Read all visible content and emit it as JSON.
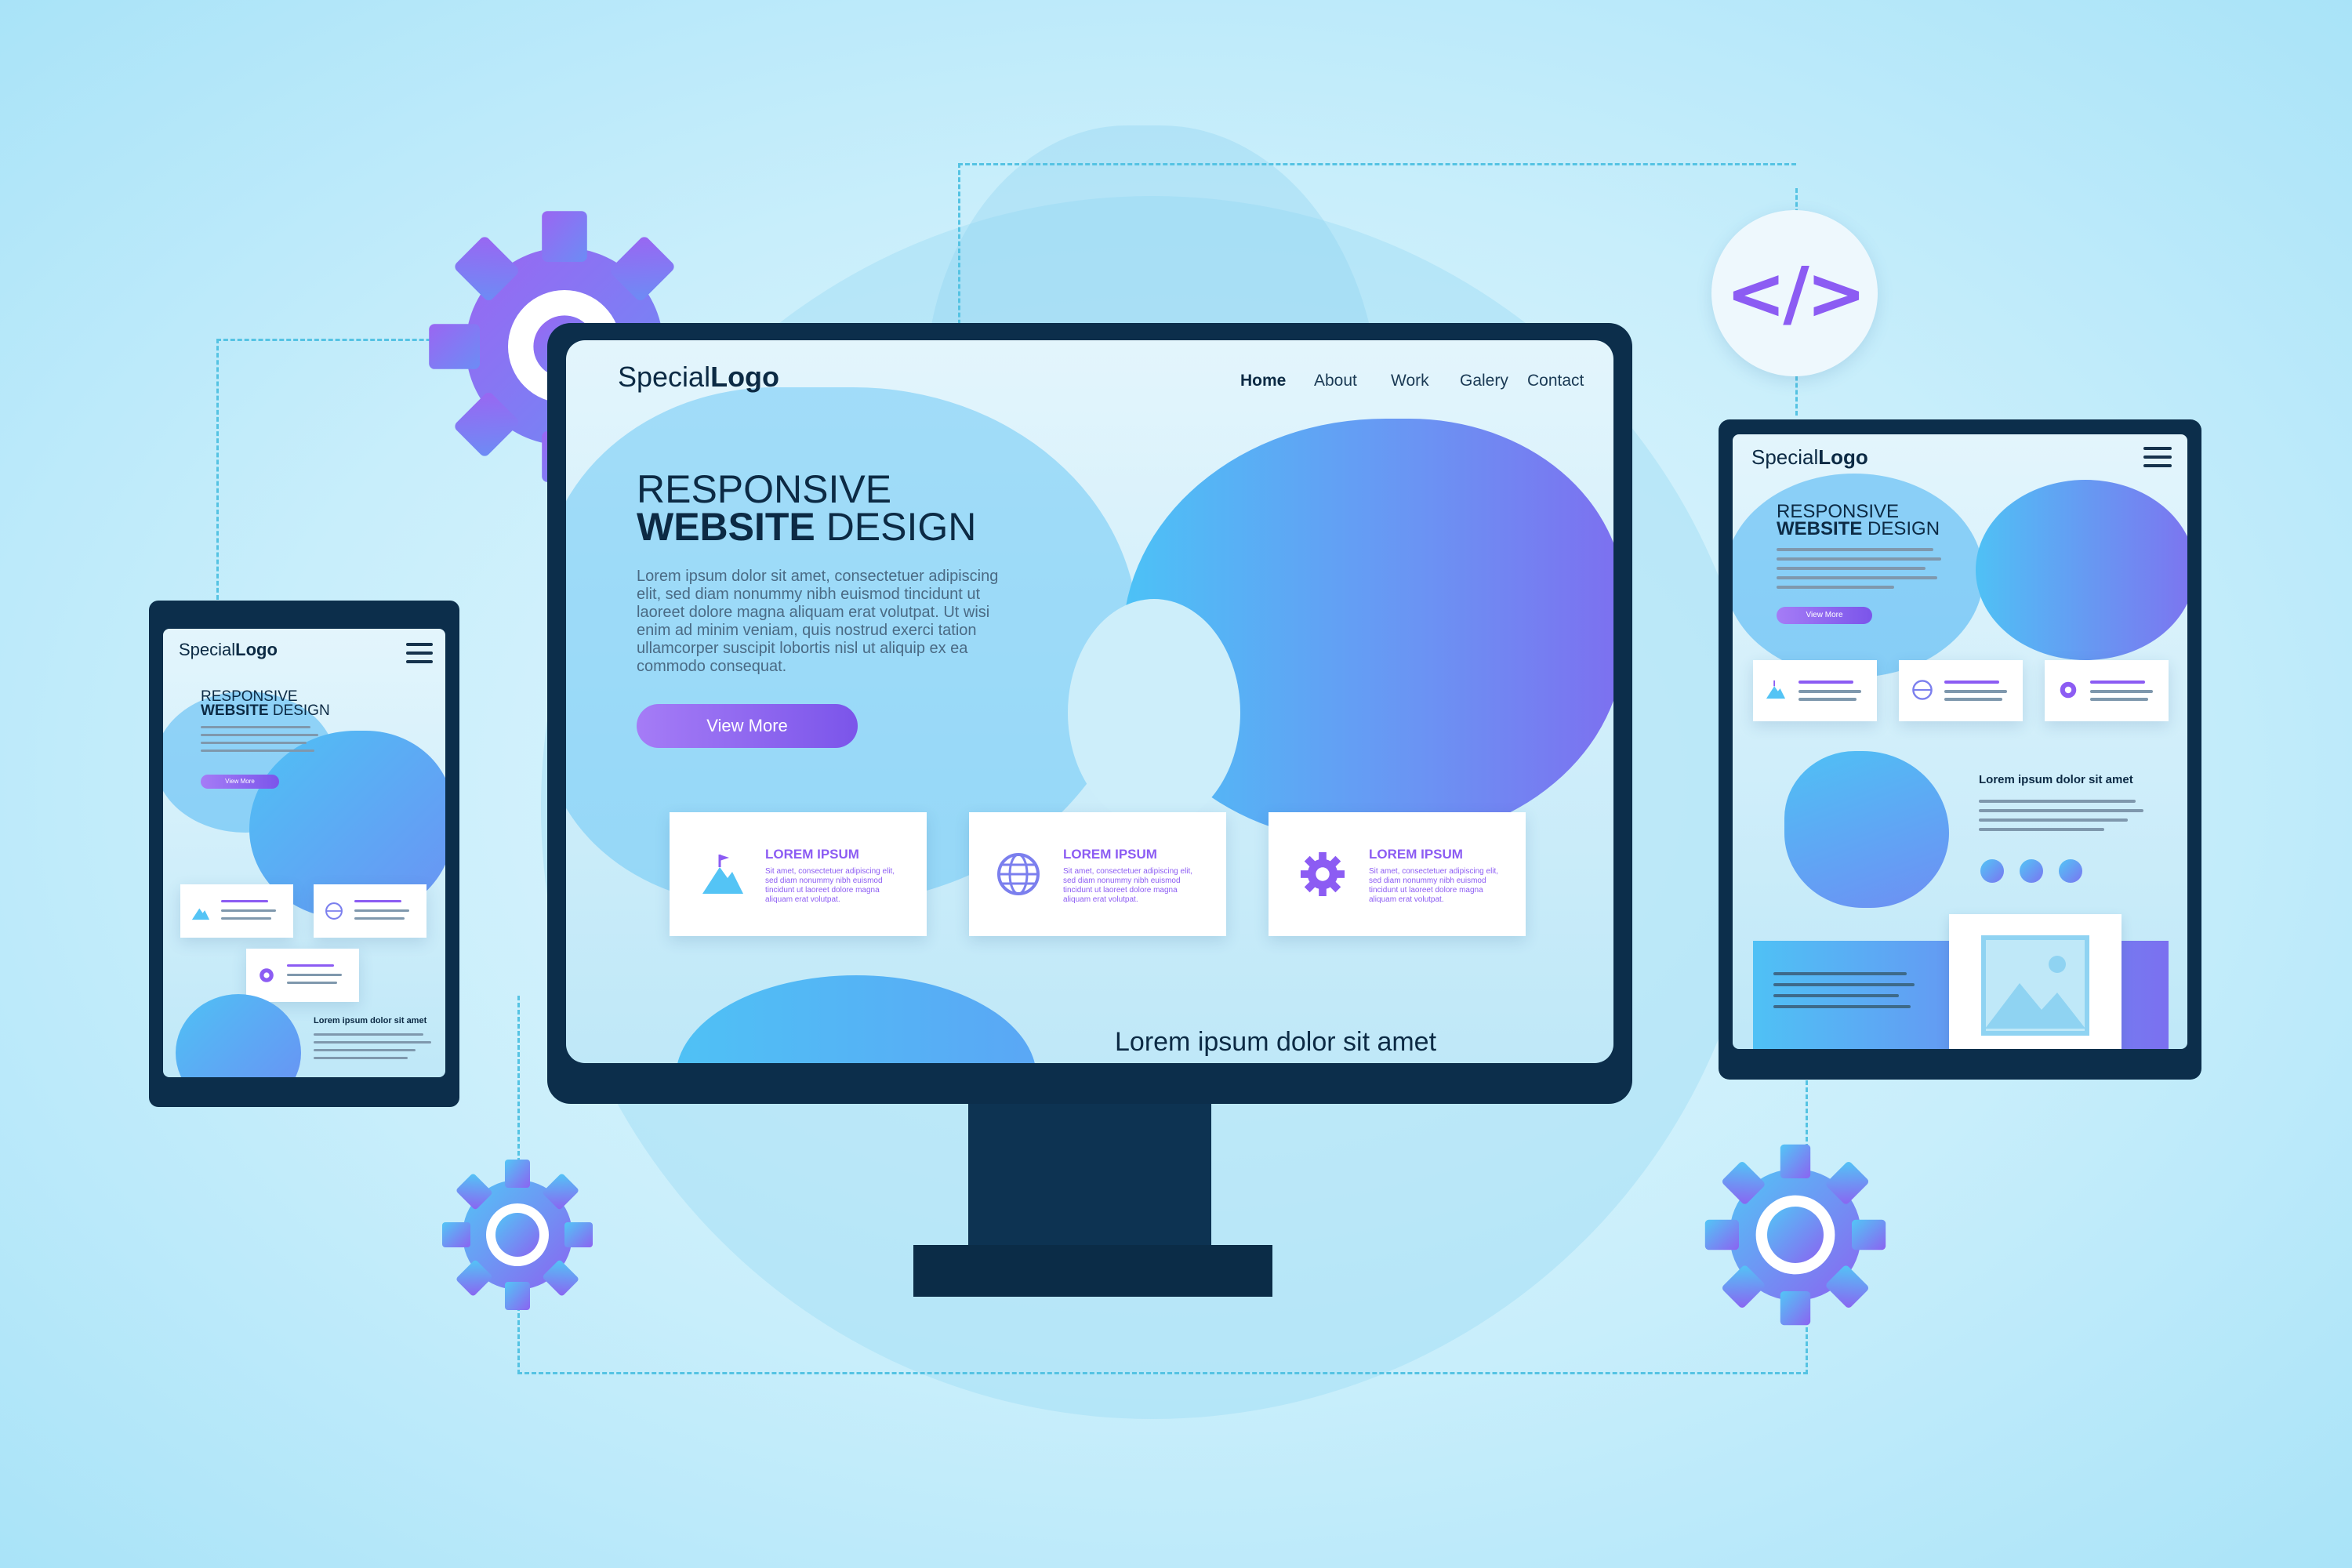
{
  "logo": {
    "regular": "Special",
    "bold": "Logo"
  },
  "nav": [
    "Home",
    "About",
    "Work",
    "Galery",
    "Contact"
  ],
  "hero": {
    "line1": "RESPONSIVE",
    "line2_bold": "WEBSITE",
    "line2_rest": " DESIGN",
    "body": "Lorem ipsum dolor sit amet, consectetuer adipiscing elit, sed diam nonummy nibh euismod tincidunt ut laoreet dolore magna aliquam erat volutpat. Ut wisi enim ad minim veniam, quis nostrud exerci tation ullamcorper suscipit lobortis nisl ut aliquip ex ea commodo consequat.",
    "button": "View More"
  },
  "cards": [
    {
      "title": "LOREM IPSUM",
      "text": "Sit amet, consectetuer adipiscing elit, sed diam nonummy nibh euismod tincidunt ut laoreet dolore magna aliquam erat volutpat.",
      "icon": "mountain-flag-icon"
    },
    {
      "title": "LOREM IPSUM",
      "text": "Sit amet, consectetuer adipiscing elit, sed diam nonummy nibh euismod tincidunt ut laoreet dolore magna aliquam erat volutpat.",
      "icon": "globe-icon"
    },
    {
      "title": "LOREM IPSUM",
      "text": "Sit amet, consectetuer adipiscing elit, sed diam nonummy nibh euismod tincidunt ut laoreet dolore magna aliquam erat volutpat.",
      "icon": "gear-icon"
    }
  ],
  "footer_heading": "Lorem ipsum dolor sit amet",
  "tablet": {
    "section_heading": "Lorem ipsum dolor sit amet"
  },
  "phone": {
    "section_heading": "Lorem ipsum dolor sit amet"
  },
  "code_badge": "</>",
  "colors": {
    "accent": "#8c5cf3",
    "dark": "#0c2a44",
    "blob": "#4fc1f5",
    "background": "#c8eefb"
  }
}
